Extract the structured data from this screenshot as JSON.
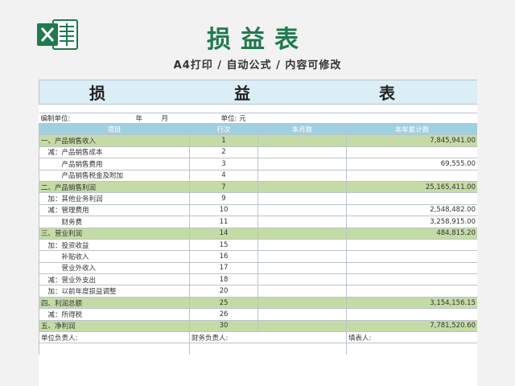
{
  "header": {
    "title": "损益表",
    "subtitle": "A4打印 / 自动公式 / 内容可修改"
  },
  "sheet": {
    "title": "损　　益　　表",
    "info": {
      "unit_label": "编制单位:",
      "year_label": "年",
      "month_label": "月",
      "currency_label": "单位: 元"
    },
    "columns": [
      "项目",
      "行次",
      "本月数",
      "本年累计数"
    ],
    "rows": [
      {
        "item": "一、产品销售收入",
        "line": "1",
        "month": "",
        "year": "7,845,941.00",
        "highlight": true
      },
      {
        "item": "　减：产品销售成本",
        "line": "2",
        "month": "",
        "year": "",
        "highlight": false
      },
      {
        "item": "　　　产品销售费用",
        "line": "3",
        "month": "",
        "year": "69,555.00",
        "highlight": false
      },
      {
        "item": "　　　产品销售税金及附加",
        "line": "4",
        "month": "",
        "year": "",
        "highlight": false
      },
      {
        "item": "二、产品销售利润",
        "line": "7",
        "month": "",
        "year": "25,165,411.00",
        "highlight": true
      },
      {
        "item": "　加：其他业务利润",
        "line": "9",
        "month": "",
        "year": "",
        "highlight": false
      },
      {
        "item": "　减：管理费用",
        "line": "10",
        "month": "",
        "year": "2,548,482.00",
        "highlight": false
      },
      {
        "item": "　　　财务费",
        "line": "11",
        "month": "",
        "year": "3,258,915.00",
        "highlight": false
      },
      {
        "item": "三、营业利润",
        "line": "14",
        "month": "",
        "year": "484,815.20",
        "highlight": true
      },
      {
        "item": "　加：投资收益",
        "line": "15",
        "month": "",
        "year": "",
        "highlight": false
      },
      {
        "item": "　　　补贴收入",
        "line": "16",
        "month": "",
        "year": "",
        "highlight": false
      },
      {
        "item": "　　　营业外收入",
        "line": "17",
        "month": "",
        "year": "",
        "highlight": false
      },
      {
        "item": "　减：营业外支出",
        "line": "18",
        "month": "",
        "year": "",
        "highlight": false
      },
      {
        "item": "　加：以前年度损益调整",
        "line": "20",
        "month": "",
        "year": "",
        "highlight": false
      },
      {
        "item": "四、利润总额",
        "line": "25",
        "month": "",
        "year": "3,154,156.15",
        "highlight": true
      },
      {
        "item": "　减：所得税",
        "line": "26",
        "month": "",
        "year": "",
        "highlight": false
      },
      {
        "item": "五、净利润",
        "line": "30",
        "month": "",
        "year": "7,781,520.60",
        "highlight": true
      }
    ],
    "signatures": {
      "unit_head": "单位负责人:",
      "finance_head": "财务负责人:",
      "preparer": "填表人:"
    }
  },
  "colors": {
    "title_green": "#1f7a4d",
    "header_blue": "#9fd0e1",
    "title_band": "#dbeef6",
    "row_green": "#c5dba6"
  },
  "icons": {
    "logo": "excel-icon"
  }
}
